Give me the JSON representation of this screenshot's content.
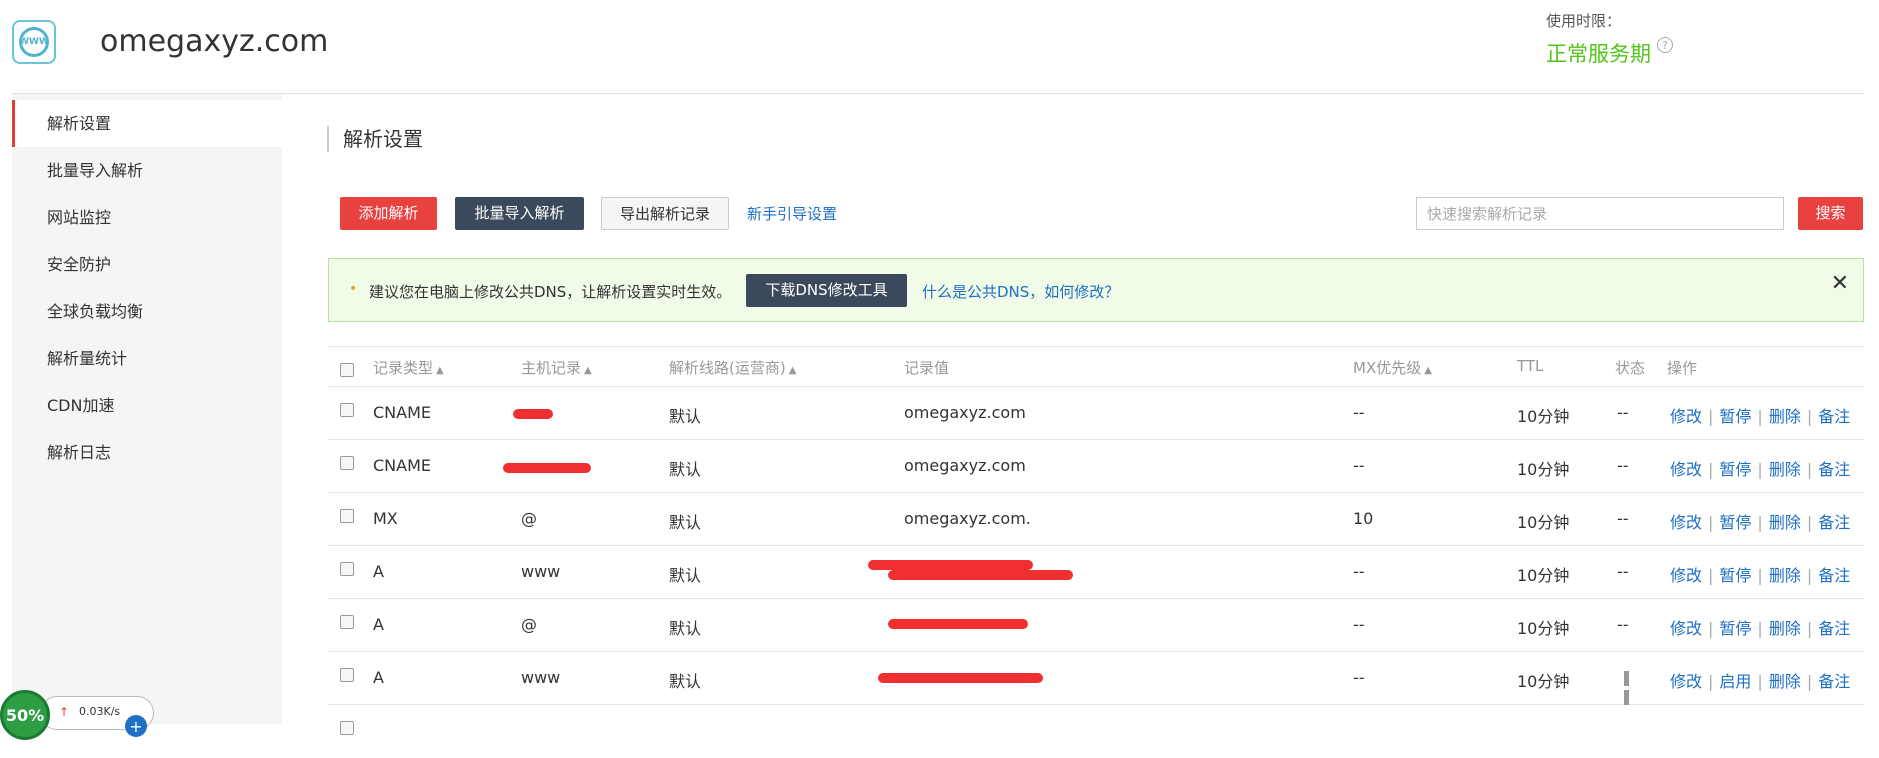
{
  "header": {
    "domain": "omegaxyz.com",
    "service_label": "使用时限：",
    "service_status": "正常服务期",
    "help_icon": "?",
    "logo_text": "WWW"
  },
  "sidebar": {
    "items": [
      {
        "label": "解析设置",
        "active": true
      },
      {
        "label": "批量导入解析"
      },
      {
        "label": "网站监控"
      },
      {
        "label": "安全防护"
      },
      {
        "label": "全球负载均衡"
      },
      {
        "label": "解析量统计"
      },
      {
        "label": "CDN加速"
      },
      {
        "label": "解析日志"
      }
    ]
  },
  "main": {
    "title": "解析设置",
    "toolbar": {
      "add": "添加解析",
      "batch_import": "批量导入解析",
      "export": "导出解析记录",
      "guide": "新手引导设置",
      "search_placeholder": "快速搜索解析记录",
      "search_button": "搜索"
    },
    "notice": {
      "bullet": "•",
      "text": "建议您在电脑上修改公共DNS，让解析设置实时生效。",
      "download_button": "下载DNS修改工具",
      "link": "什么是公共DNS，如何修改？",
      "close": "✕"
    },
    "table": {
      "headers": {
        "type": "记录类型",
        "host": "主机记录",
        "line": "解析线路(运营商)",
        "value": "记录值",
        "mx": "MX优先级",
        "ttl": "TTL",
        "status": "状态",
        "ops": "操作"
      },
      "rows": [
        {
          "type": "CNAME",
          "host": "",
          "line": "默认",
          "value": "omegaxyz.com",
          "mx": "--",
          "ttl": "10分钟",
          "status": "--",
          "ops": [
            "修改",
            "暂停",
            "删除",
            "备注"
          ]
        },
        {
          "type": "CNAME",
          "host": "",
          "line": "默认",
          "value": "omegaxyz.com",
          "mx": "--",
          "ttl": "10分钟",
          "status": "--",
          "ops": [
            "修改",
            "暂停",
            "删除",
            "备注"
          ]
        },
        {
          "type": "MX",
          "host": "@",
          "line": "默认",
          "value": "omegaxyz.com.",
          "mx": "10",
          "ttl": "10分钟",
          "status": "--",
          "ops": [
            "修改",
            "暂停",
            "删除",
            "备注"
          ]
        },
        {
          "type": "A",
          "host": "www",
          "line": "默认",
          "value": "",
          "mx": "--",
          "ttl": "10分钟",
          "status": "--",
          "ops": [
            "修改",
            "暂停",
            "删除",
            "备注"
          ]
        },
        {
          "type": "A",
          "host": "@",
          "line": "默认",
          "value": "",
          "mx": "--",
          "ttl": "10分钟",
          "status": "--",
          "ops": [
            "修改",
            "暂停",
            "删除",
            "备注"
          ]
        },
        {
          "type": "A",
          "host": "www",
          "line": "默认",
          "value": "",
          "mx": "--",
          "ttl": "10分钟",
          "status": "",
          "ops": [
            "修改",
            "启用",
            "删除",
            "备注"
          ]
        }
      ]
    }
  },
  "netwidget": {
    "percent": "50%",
    "speed": "0.03K/s",
    "arrow": "↑",
    "plus": "+"
  }
}
